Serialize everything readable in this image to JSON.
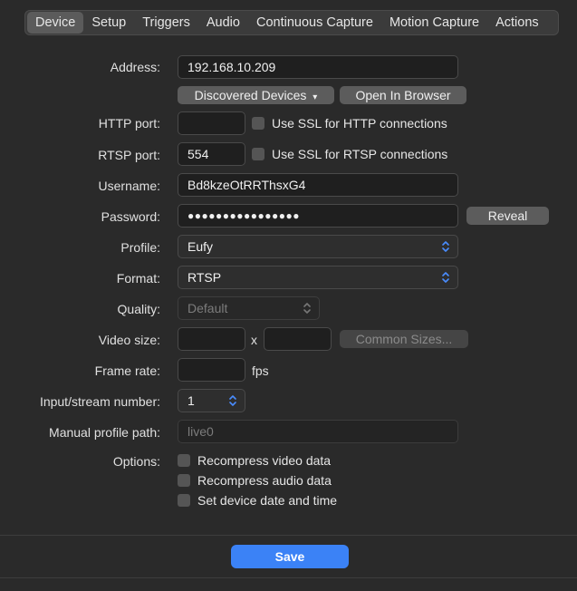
{
  "tabs": [
    {
      "label": "Device",
      "active": true
    },
    {
      "label": "Setup"
    },
    {
      "label": "Triggers"
    },
    {
      "label": "Audio"
    },
    {
      "label": "Continuous Capture"
    },
    {
      "label": "Motion Capture"
    },
    {
      "label": "Actions"
    }
  ],
  "form": {
    "address_label": "Address:",
    "address_value": "192.168.10.209",
    "discovered_devices_label": "Discovered Devices",
    "open_in_browser_label": "Open In Browser",
    "http_port_label": "HTTP port:",
    "http_port_value": "",
    "ssl_http_label": "Use SSL for HTTP connections",
    "rtsp_port_label": "RTSP port:",
    "rtsp_port_value": "554",
    "ssl_rtsp_label": "Use SSL for RTSP connections",
    "username_label": "Username:",
    "username_value": "Bd8kzeOtRRThsxG4",
    "password_label": "Password:",
    "password_value": "●●●●●●●●●●●●●●●●",
    "reveal_label": "Reveal",
    "profile_label": "Profile:",
    "profile_value": "Eufy",
    "format_label": "Format:",
    "format_value": "RTSP",
    "quality_label": "Quality:",
    "quality_value": "Default",
    "video_size_label": "Video size:",
    "video_size_x": "x",
    "common_sizes_label": "Common Sizes...",
    "frame_rate_label": "Frame rate:",
    "fps_label": "fps",
    "stream_number_label": "Input/stream number:",
    "stream_number_value": "1",
    "manual_path_label": "Manual profile path:",
    "manual_path_placeholder": "live0",
    "options_label": "Options:",
    "options": [
      "Recompress video data",
      "Recompress audio data",
      "Set device date and time"
    ]
  },
  "footer": {
    "save_label": "Save",
    "accent": "#3b82f6"
  },
  "icons": {
    "dropdown_arrow": "▾"
  }
}
